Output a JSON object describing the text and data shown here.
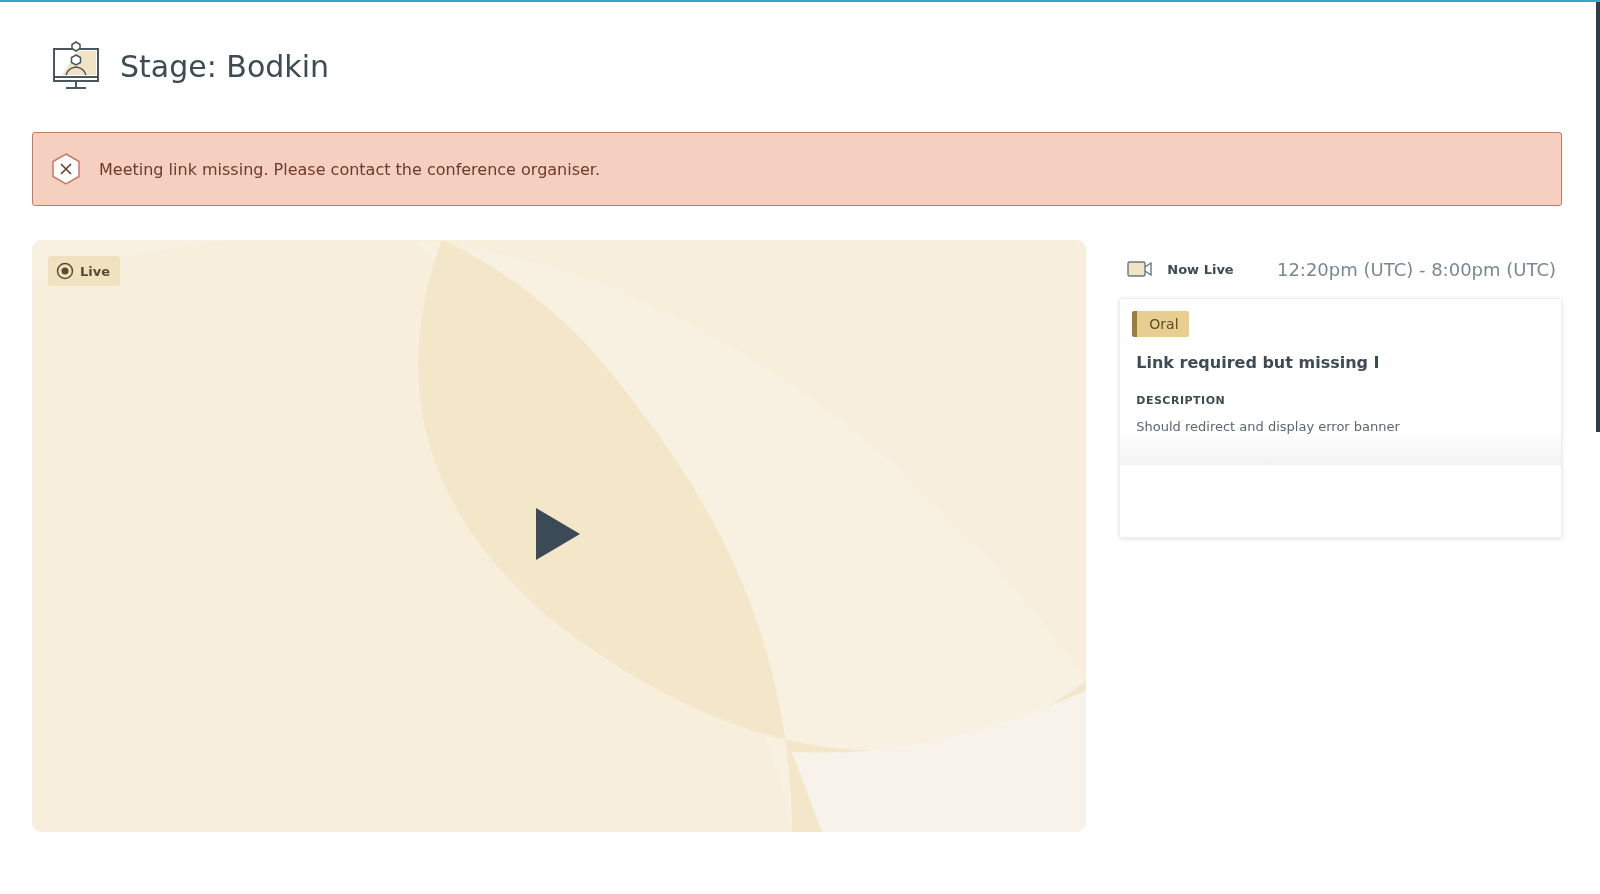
{
  "header": {
    "title": "Stage: Bodkin"
  },
  "alert": {
    "kind": "error",
    "message": "Meeting link missing. Please contact the conference organiser."
  },
  "video": {
    "badge": "Live"
  },
  "schedule": {
    "status": "Now Live",
    "time": "12:20pm (UTC) - 8:00pm (UTC)"
  },
  "session": {
    "tag": "Oral",
    "title": "Link required but missing I",
    "description_label": "DESCRIPTION",
    "description": "Should redirect and display error banner"
  }
}
